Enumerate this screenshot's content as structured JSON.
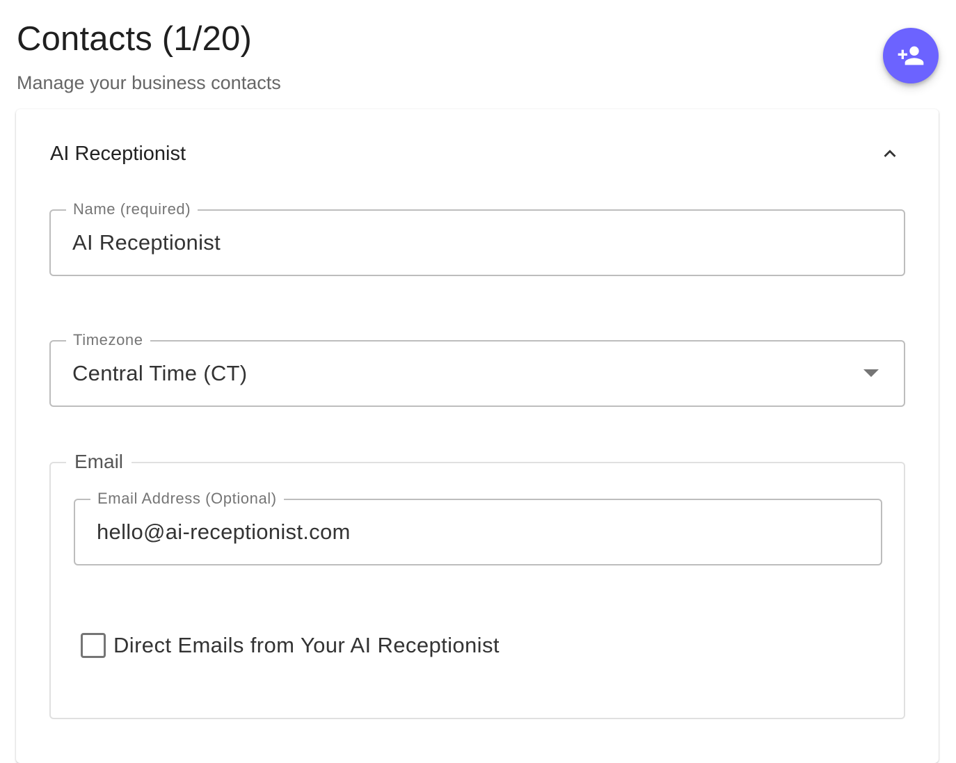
{
  "header": {
    "title": "Contacts (1/20)",
    "subtitle": "Manage your business contacts",
    "add_contact_icon": "person-add-icon",
    "accent_color": "#6c63ff"
  },
  "contact_card": {
    "title": "AI Receptionist",
    "collapse_icon": "chevron-up-icon",
    "name_field": {
      "label": "Name (required)",
      "value": "AI Receptionist"
    },
    "timezone_field": {
      "label": "Timezone",
      "value": "Central Time (CT)",
      "dropdown_icon": "caret-down-icon"
    },
    "email_group": {
      "legend": "Email",
      "email_field": {
        "label": "Email Address (Optional)",
        "value": "hello@ai-receptionist.com"
      },
      "direct_emails_checkbox": {
        "label": "Direct Emails from Your AI Receptionist",
        "checked": false
      }
    }
  }
}
